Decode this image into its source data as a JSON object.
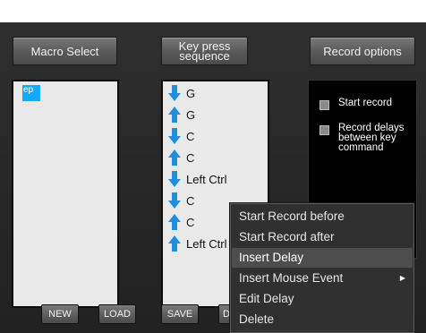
{
  "header": {
    "macro_select": "Macro Select",
    "key_press_line1": "Key press",
    "key_press_line2": "sequence",
    "record_options": "Record options"
  },
  "macro_list": {
    "items": [
      "ep"
    ]
  },
  "sequence": {
    "items": [
      {
        "dir": "down",
        "label": "G"
      },
      {
        "dir": "up",
        "label": "G"
      },
      {
        "dir": "down",
        "label": "C"
      },
      {
        "dir": "up",
        "label": "C"
      },
      {
        "dir": "down",
        "label": "Left Ctrl"
      },
      {
        "dir": "down",
        "label": "C"
      },
      {
        "dir": "up",
        "label": "C"
      },
      {
        "dir": "up",
        "label": "Left Ctrl"
      }
    ]
  },
  "record_options": {
    "start_record": "Start record",
    "record_delays": "Record delays between key command"
  },
  "bottom": {
    "new": "NEW",
    "load": "LOAD",
    "save": "SAVE",
    "d": "D"
  },
  "context_menu": {
    "items": [
      "Start Record before",
      "Start Record after",
      "Insert Delay",
      "Insert Mouse Event",
      "Edit Delay",
      "Delete"
    ],
    "highlighted_index": 2,
    "submenu_indicator": "▶"
  },
  "colors": {
    "selection": "#14a9ff",
    "arrow": "#1e8fe0",
    "background": "#262626"
  }
}
